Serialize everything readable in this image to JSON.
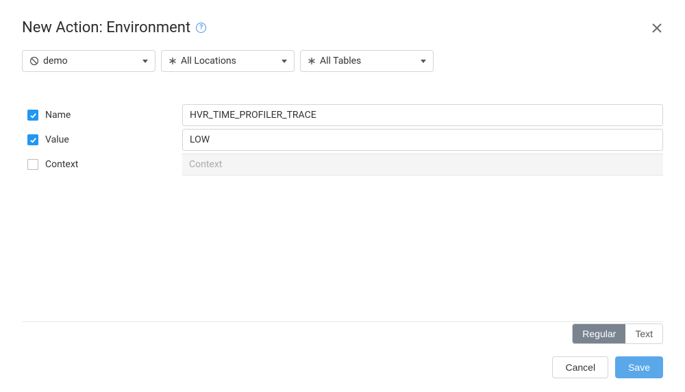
{
  "header": {
    "title": "New Action: Environment"
  },
  "filters": {
    "channel": {
      "label": "demo",
      "iconName": "channel-icon"
    },
    "locations": {
      "label": "All Locations",
      "iconName": "asterisk-icon"
    },
    "tables": {
      "label": "All Tables",
      "iconName": "asterisk-icon"
    }
  },
  "fields": {
    "name": {
      "label": "Name",
      "checked": true,
      "value": "HVR_TIME_PROFILER_TRACE"
    },
    "value": {
      "label": "Value",
      "checked": true,
      "value": "LOW"
    },
    "context": {
      "label": "Context",
      "checked": false,
      "value": "",
      "placeholder": "Context"
    }
  },
  "viewToggle": {
    "options": [
      "Regular",
      "Text"
    ],
    "active": "Regular"
  },
  "actions": {
    "cancel": "Cancel",
    "save": "Save"
  }
}
